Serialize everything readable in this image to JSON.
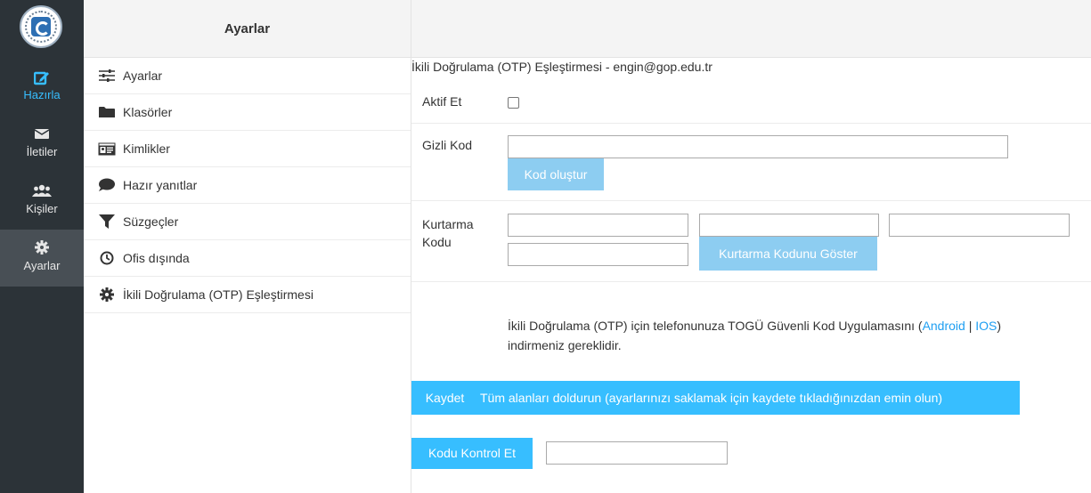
{
  "appbar": {
    "items": [
      {
        "label": "Hazırla",
        "icon": "compose-icon",
        "color": "#37beff"
      },
      {
        "label": "İletiler",
        "icon": "envelope-icon"
      },
      {
        "label": "Kişiler",
        "icon": "users-icon"
      },
      {
        "label": "Ayarlar",
        "icon": "gear-icon",
        "selected": true
      }
    ]
  },
  "settings_list": {
    "title": "Ayarlar",
    "items": [
      {
        "label": "Ayarlar",
        "icon": "sliders-icon"
      },
      {
        "label": "Klasörler",
        "icon": "folder-icon"
      },
      {
        "label": "Kimlikler",
        "icon": "id-card-icon"
      },
      {
        "label": "Hazır yanıtlar",
        "icon": "speech-bubble-icon"
      },
      {
        "label": "Süzgeçler",
        "icon": "filter-icon"
      },
      {
        "label": "Ofis dışında",
        "icon": "clock-icon"
      },
      {
        "label": "İkili Doğrulama (OTP) Eşleştirmesi",
        "icon": "gear-icon"
      }
    ]
  },
  "otp": {
    "title": "İkili Doğrulama (OTP) Eşleştirmesi - engin@gop.edu.tr",
    "activate_label": "Aktif Et",
    "activate_checked": false,
    "secret_label": "Gizli Kod",
    "secret_value": "",
    "generate_button": "Kod oluştur",
    "recovery_label_line1": "Kurtarma",
    "recovery_label_line2": "Kodu",
    "recovery_codes": [
      "",
      "",
      "",
      ""
    ],
    "show_recovery_button": "Kurtarma Kodunu Göster",
    "info_text_1": "İkili Doğrulama (OTP) için telefonunuza TOGÜ Güvenli Kod Uygulamasını (",
    "android_link": "Android",
    "link_separator": "|",
    "ios_link": "IOS",
    "info_text_2": ")",
    "info_text_3": "indirmeniz gereklidir.",
    "save_button": "Kaydet",
    "save_message": "Tüm alanları doldurun (ayarlarınızı saklamak için kaydete tıkladığınızdan emin olun)",
    "check_button": "Kodu Kontrol Et",
    "check_value": ""
  },
  "colors": {
    "appbar_bg": "#2c3338",
    "accent": "#37beff",
    "button_light": "#8dcdf1",
    "link": "#1e9ff2"
  }
}
